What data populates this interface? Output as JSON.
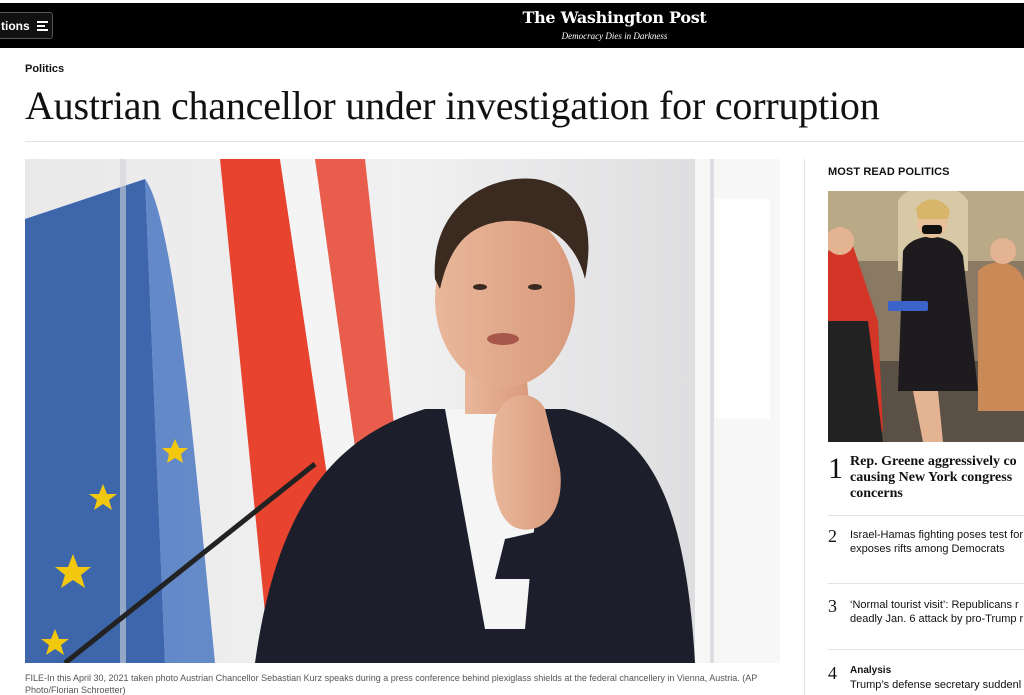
{
  "header": {
    "sections_label": "tions",
    "logo": "The Washington Post",
    "tagline": "Democracy Dies in Darkness"
  },
  "article": {
    "kicker": "Politics",
    "headline": "Austrian chancellor under investigation for corruption",
    "caption": "FILE-In this April 30, 2021 taken photo Austrian Chancellor Sebastian Kurz speaks during a press conference behind plexiglass shields at the federal chancellery in Vienna, Austria. (AP Photo/Florian Schroetter)"
  },
  "sidebar": {
    "title": "MOST READ POLITICS",
    "items": [
      {
        "number": "1",
        "lines": [
          "Rep. Greene aggressively co",
          "causing New York congress",
          "concerns"
        ]
      },
      {
        "number": "2",
        "lines": [
          "Israel-Hamas fighting poses test for",
          "exposes rifts among Democrats"
        ]
      },
      {
        "number": "3",
        "lines": [
          "‘Normal tourist visit’: Republicans r",
          "deadly Jan. 6 attack by pro-Trump r"
        ]
      },
      {
        "number": "4",
        "label": "Analysis",
        "lines": [
          "Trump’s defense secretary suddenl"
        ]
      }
    ]
  },
  "colors": {
    "topbar": "#000000",
    "flag_red": "#e8432f",
    "eu_blue": "#1f4fa0",
    "eu_star": "#f2c80f"
  }
}
